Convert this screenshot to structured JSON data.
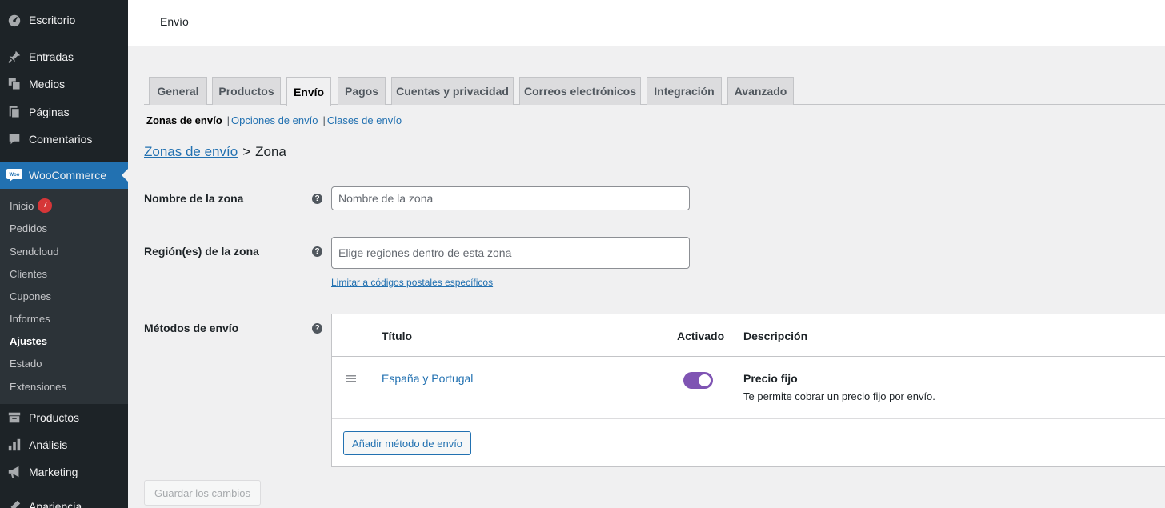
{
  "header": {
    "title": "Envío"
  },
  "sidebar": {
    "items": [
      {
        "label": "Escritorio",
        "icon": "dashboard-icon"
      },
      {
        "label": "Entradas",
        "icon": "pin-icon"
      },
      {
        "label": "Medios",
        "icon": "media-icon"
      },
      {
        "label": "Páginas",
        "icon": "pages-icon"
      },
      {
        "label": "Comentarios",
        "icon": "comments-icon"
      },
      {
        "label": "WooCommerce",
        "icon": "woo-icon"
      },
      {
        "label": "Productos",
        "icon": "archive-icon"
      },
      {
        "label": "Análisis",
        "icon": "chart-icon"
      },
      {
        "label": "Marketing",
        "icon": "megaphone-icon"
      },
      {
        "label": "Apariencia",
        "icon": "brush-icon"
      }
    ],
    "submenu": [
      {
        "label": "Inicio",
        "badge": "7"
      },
      {
        "label": "Pedidos"
      },
      {
        "label": "Sendcloud"
      },
      {
        "label": "Clientes"
      },
      {
        "label": "Cupones"
      },
      {
        "label": "Informes"
      },
      {
        "label": "Ajustes"
      },
      {
        "label": "Estado"
      },
      {
        "label": "Extensiones"
      }
    ]
  },
  "tabs": [
    {
      "label": "General"
    },
    {
      "label": "Productos"
    },
    {
      "label": "Envío"
    },
    {
      "label": "Pagos"
    },
    {
      "label": "Cuentas y privacidad"
    },
    {
      "label": "Correos electrónicos"
    },
    {
      "label": "Integración"
    },
    {
      "label": "Avanzado"
    }
  ],
  "subnav": {
    "current": "Zonas de envío",
    "sep": "|",
    "links": [
      "Opciones de envío",
      "Clases de envío"
    ]
  },
  "breadcrumb": {
    "link": "Zonas de envío",
    "sep": ">",
    "current": "Zona"
  },
  "form": {
    "zone_name": {
      "label": "Nombre de la zona",
      "placeholder": "Nombre de la zona",
      "value": ""
    },
    "zone_regions": {
      "label": "Región(es) de la zona",
      "placeholder": "Elige regiones dentro de esta zona",
      "value": "",
      "postcode_link": "Limitar a códigos postales específicos"
    },
    "methods": {
      "label": "Métodos de envío",
      "columns": {
        "title": "Título",
        "enabled": "Activado",
        "description": "Descripción"
      },
      "rows": [
        {
          "title": "España y Portugal",
          "enabled": true,
          "desc_title": "Precio fijo",
          "desc_text": "Te permite cobrar un precio fijo por envío."
        }
      ],
      "add_button": "Añadir método de envío"
    },
    "help_glyph": "?"
  },
  "save_button": "Guardar los cambios",
  "colors": {
    "sidebar_bg": "#1d2327",
    "accent": "#2271b1",
    "toggle_on": "#7f54b3",
    "badge": "#d63638"
  }
}
